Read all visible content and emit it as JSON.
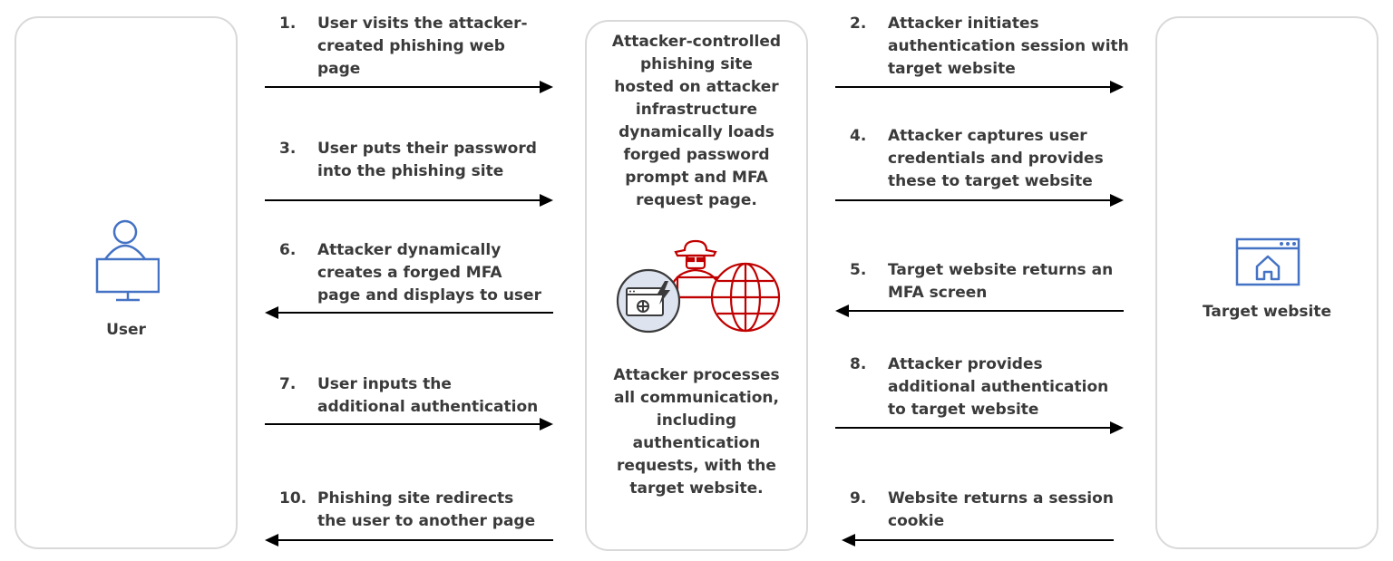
{
  "colors": {
    "icon_blue": "#4472c4",
    "attacker_red": "#c00000",
    "text": "#3a3a3a",
    "box_border": "#d9d9d9",
    "browser_circle_fill": "#dde3ef"
  },
  "actors": {
    "user": {
      "label": "User",
      "icon": "user-at-computer-icon"
    },
    "attacker": {
      "top_text": "Attacker-controlled\nphishing site\nhosted on attacker\ninfrastructure\ndynamically loads\nforged password\nprompt and MFA\nrequest page.",
      "bottom_text": "Attacker processes\nall communication,\nincluding\nauthentication\nrequests, with the\ntarget website.",
      "icon": "hacker-phishing-globe-icon"
    },
    "target": {
      "label": "Target website",
      "icon": "browser-home-icon"
    }
  },
  "left_steps": [
    {
      "num": "1.",
      "text": "User visits the attacker-\ncreated phishing web\npage",
      "direction": "right"
    },
    {
      "num": "3.",
      "text": "User puts their password\ninto the phishing site",
      "direction": "right"
    },
    {
      "num": "6.",
      "text": "Attacker dynamically\ncreates a forged MFA\npage and displays to user",
      "direction": "left"
    },
    {
      "num": "7.",
      "text": "User inputs the\nadditional authentication",
      "direction": "right"
    },
    {
      "num": "10.",
      "text": "Phishing site redirects\nthe user to another page",
      "direction": "left"
    }
  ],
  "right_steps": [
    {
      "num": "2.",
      "text": "Attacker initiates\nauthentication session with\ntarget website",
      "direction": "right"
    },
    {
      "num": "4.",
      "text": "Attacker captures user\ncredentials and provides\nthese to target website",
      "direction": "right"
    },
    {
      "num": "5.",
      "text": "Target website returns an\nMFA screen",
      "direction": "left"
    },
    {
      "num": "8.",
      "text": "Attacker provides\nadditional authentication\nto target website",
      "direction": "right"
    },
    {
      "num": "9.",
      "text": "Website returns a session\ncookie",
      "direction": "left"
    }
  ]
}
